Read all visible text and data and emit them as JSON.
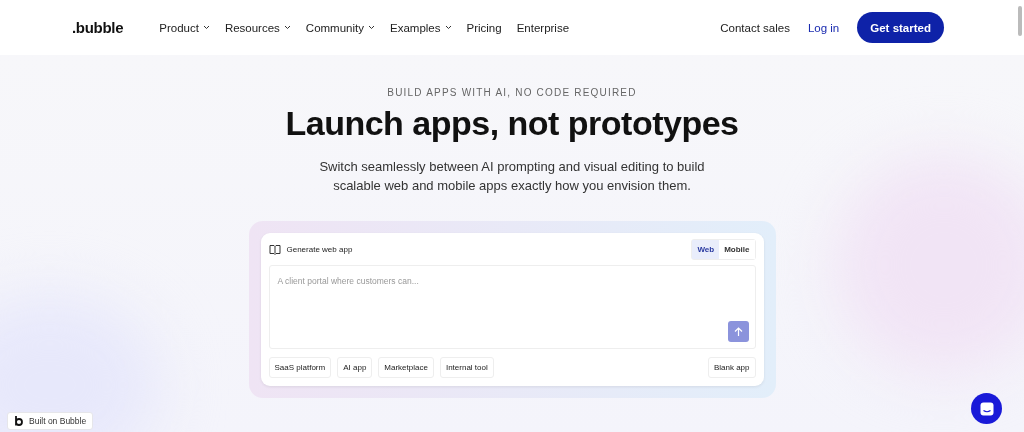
{
  "logo": ".bubble",
  "nav": [
    {
      "label": "Product",
      "kind": "menu"
    },
    {
      "label": "Resources",
      "kind": "menu"
    },
    {
      "label": "Community",
      "kind": "menu"
    },
    {
      "label": "Examples",
      "kind": "menu"
    },
    {
      "label": "Pricing",
      "kind": "link"
    },
    {
      "label": "Enterprise",
      "kind": "link"
    }
  ],
  "actions": {
    "contact": "Contact sales",
    "login": "Log in",
    "cta": "Get started"
  },
  "hero": {
    "eyebrow": "BUILD APPS WITH AI, NO CODE REQUIRED",
    "title": "Launch apps, not prototypes",
    "subtitle": "Switch seamlessly between AI prompting and visual editing to build scalable web and mobile apps exactly how you envision them."
  },
  "generator": {
    "label": "Generate web app",
    "tabs": [
      {
        "label": "Web",
        "selected": true
      },
      {
        "label": "Mobile",
        "selected": false
      }
    ],
    "placeholder": "A client portal where customers can...",
    "chips": [
      "SaaS platform",
      "AI app",
      "Marketplace",
      "Internal tool"
    ],
    "blank": "Blank app"
  },
  "badge": "Built on Bubble"
}
